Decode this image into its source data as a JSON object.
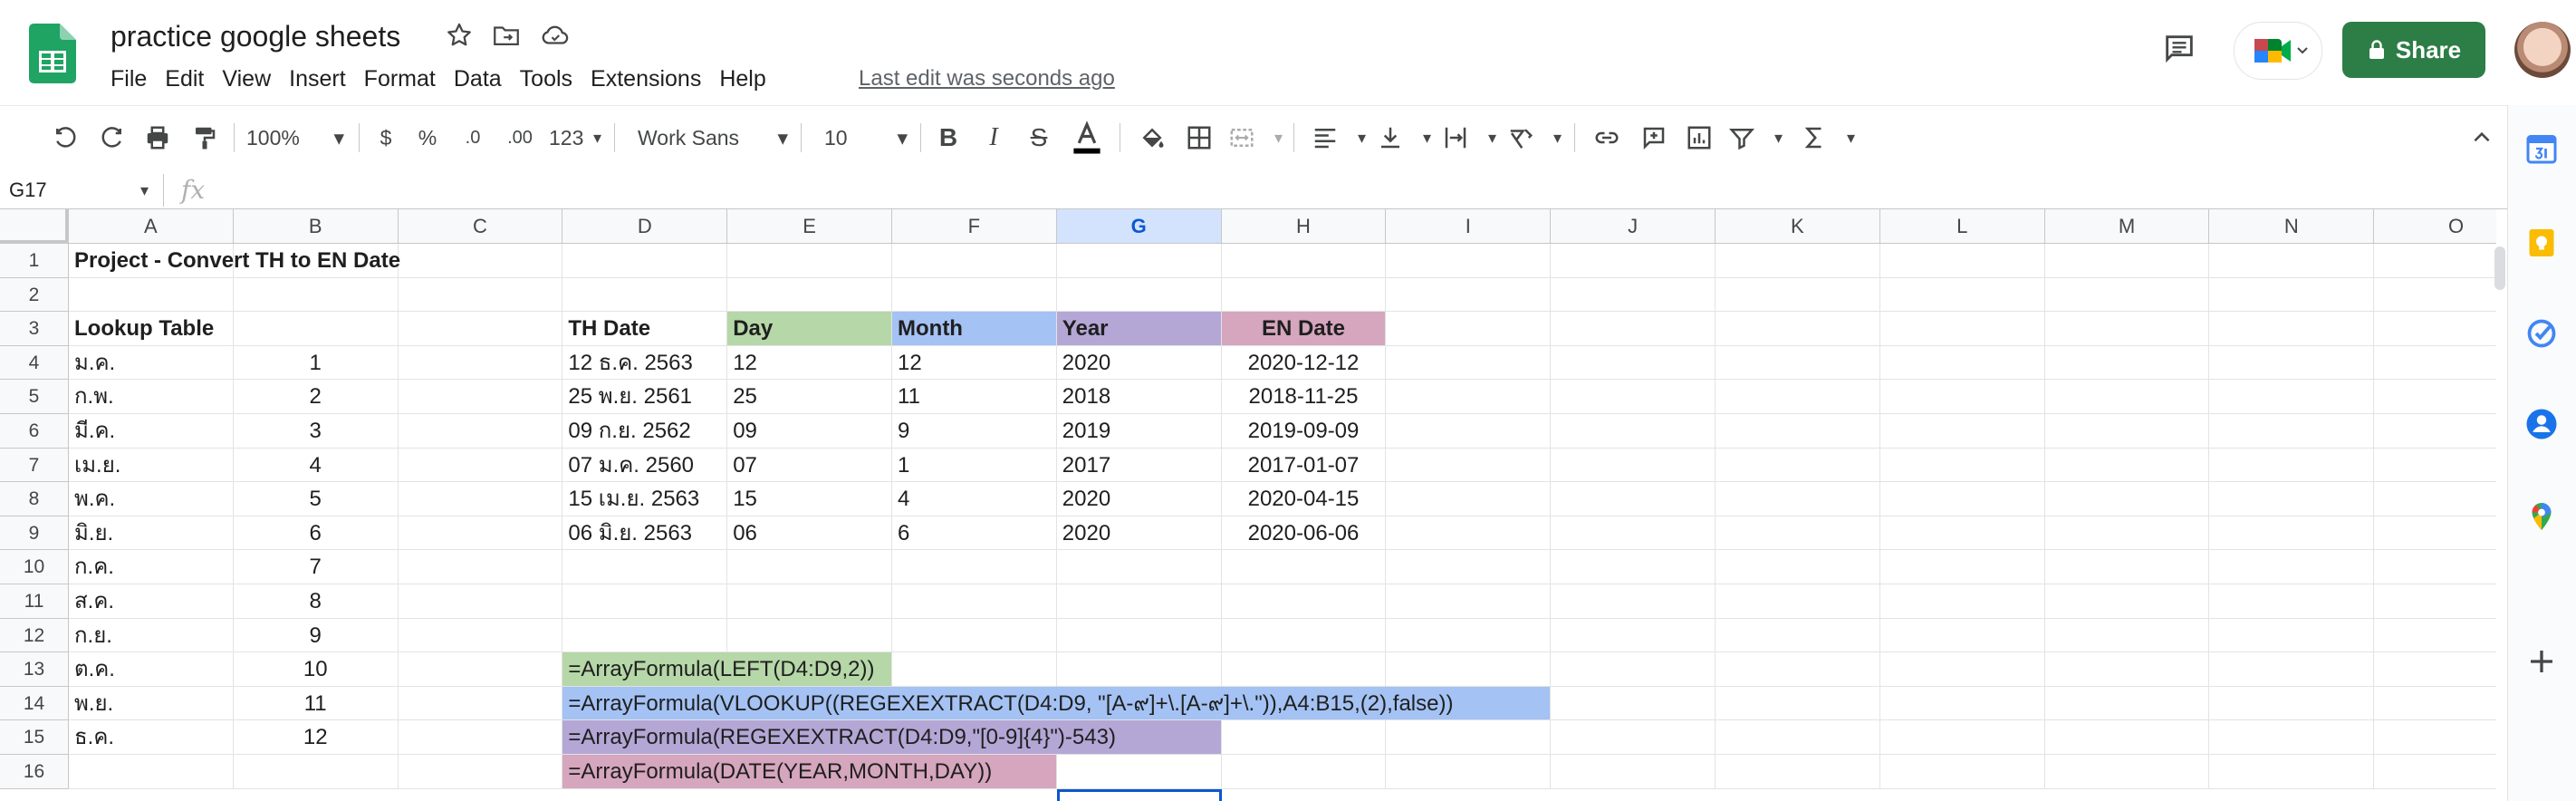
{
  "app": {
    "title": "practice google sheets",
    "last_edit": "Last edit was seconds ago",
    "share_label": "Share"
  },
  "menu": [
    "File",
    "Edit",
    "View",
    "Insert",
    "Format",
    "Data",
    "Tools",
    "Extensions",
    "Help"
  ],
  "toolbar": {
    "zoom": "100%",
    "currency": "$",
    "percent": "%",
    "dec_decrease": ".0",
    "dec_increase": ".00",
    "more_formats": "123",
    "font": "Work Sans",
    "font_size": "10"
  },
  "formula_bar": {
    "name_box": "G17",
    "fx": "fx",
    "value": ""
  },
  "grid": {
    "columns": [
      "A",
      "B",
      "C",
      "D",
      "E",
      "F",
      "G",
      "H",
      "I",
      "J",
      "K",
      "L",
      "M",
      "N",
      "O"
    ],
    "selected_column": "G",
    "rows": [
      "1",
      "2",
      "3",
      "4",
      "5",
      "6",
      "7",
      "8",
      "9",
      "10",
      "11",
      "12",
      "13",
      "14",
      "15",
      "16"
    ],
    "cells": [
      {
        "ref": "A1",
        "value": "Project - Convert TH to EN Date",
        "bold": true
      },
      {
        "ref": "A3",
        "value": "Lookup Table",
        "bold": true
      },
      {
        "ref": "D3",
        "value": "TH Date",
        "bold": true
      },
      {
        "ref": "E3",
        "value": "Day",
        "bold": true,
        "fill": "#b6d7a8"
      },
      {
        "ref": "F3",
        "value": "Month",
        "bold": true,
        "fill": "#a4c2f4"
      },
      {
        "ref": "G3",
        "value": "Year",
        "bold": true,
        "fill": "#b4a7d6"
      },
      {
        "ref": "H3",
        "value": "EN Date",
        "bold": true,
        "fill": "#d5a6bd",
        "align": "center"
      },
      {
        "ref": "A4",
        "value": "ม.ค."
      },
      {
        "ref": "B4",
        "value": "1",
        "align": "center"
      },
      {
        "ref": "A5",
        "value": "ก.พ."
      },
      {
        "ref": "B5",
        "value": "2",
        "align": "center"
      },
      {
        "ref": "A6",
        "value": "มี.ค."
      },
      {
        "ref": "B6",
        "value": "3",
        "align": "center"
      },
      {
        "ref": "A7",
        "value": "เม.ย."
      },
      {
        "ref": "B7",
        "value": "4",
        "align": "center"
      },
      {
        "ref": "A8",
        "value": "พ.ค."
      },
      {
        "ref": "B8",
        "value": "5",
        "align": "center"
      },
      {
        "ref": "A9",
        "value": "มิ.ย."
      },
      {
        "ref": "B9",
        "value": "6",
        "align": "center"
      },
      {
        "ref": "A10",
        "value": "ก.ค."
      },
      {
        "ref": "B10",
        "value": "7",
        "align": "center"
      },
      {
        "ref": "A11",
        "value": "ส.ค."
      },
      {
        "ref": "B11",
        "value": "8",
        "align": "center"
      },
      {
        "ref": "A12",
        "value": "ก.ย."
      },
      {
        "ref": "B12",
        "value": "9",
        "align": "center"
      },
      {
        "ref": "A13",
        "value": "ต.ค."
      },
      {
        "ref": "B13",
        "value": "10",
        "align": "center"
      },
      {
        "ref": "A14",
        "value": "พ.ย."
      },
      {
        "ref": "B14",
        "value": "11",
        "align": "center"
      },
      {
        "ref": "A15",
        "value": "ธ.ค."
      },
      {
        "ref": "B15",
        "value": "12",
        "align": "center"
      },
      {
        "ref": "D4",
        "value": "12 ธ.ค. 2563"
      },
      {
        "ref": "E4",
        "value": "12"
      },
      {
        "ref": "F4",
        "value": "12"
      },
      {
        "ref": "G4",
        "value": "2020"
      },
      {
        "ref": "H4",
        "value": "2020-12-12",
        "align": "center"
      },
      {
        "ref": "D5",
        "value": "25 พ.ย. 2561"
      },
      {
        "ref": "E5",
        "value": "25"
      },
      {
        "ref": "F5",
        "value": "11"
      },
      {
        "ref": "G5",
        "value": "2018"
      },
      {
        "ref": "H5",
        "value": "2018-11-25",
        "align": "center"
      },
      {
        "ref": "D6",
        "value": "09 ก.ย. 2562"
      },
      {
        "ref": "E6",
        "value": "09"
      },
      {
        "ref": "F6",
        "value": "9"
      },
      {
        "ref": "G6",
        "value": "2019"
      },
      {
        "ref": "H6",
        "value": "2019-09-09",
        "align": "center"
      },
      {
        "ref": "D7",
        "value": "07 ม.ค. 2560"
      },
      {
        "ref": "E7",
        "value": "07"
      },
      {
        "ref": "F7",
        "value": "1"
      },
      {
        "ref": "G7",
        "value": "2017"
      },
      {
        "ref": "H7",
        "value": "2017-01-07",
        "align": "center"
      },
      {
        "ref": "D8",
        "value": "15 เม.ย. 2563"
      },
      {
        "ref": "E8",
        "value": "15"
      },
      {
        "ref": "F8",
        "value": "4"
      },
      {
        "ref": "G8",
        "value": "2020"
      },
      {
        "ref": "H8",
        "value": "2020-04-15",
        "align": "center"
      },
      {
        "ref": "D9",
        "value": "06 มิ.ย. 2563"
      },
      {
        "ref": "E9",
        "value": "06"
      },
      {
        "ref": "F9",
        "value": "6"
      },
      {
        "ref": "G9",
        "value": "2020"
      },
      {
        "ref": "H9",
        "value": "2020-06-06",
        "align": "center"
      }
    ],
    "formula_notes": [
      {
        "ref": "D13",
        "span": 2,
        "value": "=ArrayFormula(LEFT(D4:D9,2))",
        "fill": "#b6d7a8"
      },
      {
        "ref": "D14",
        "span": 6,
        "value": "=ArrayFormula(VLOOKUP((REGEXEXTRACT(D4:D9, \"[A-๙]+\\.[A-๙]+\\.\")),A4:B15,(2),false))",
        "fill": "#a4c2f4"
      },
      {
        "ref": "D15",
        "span": 4,
        "value": "=ArrayFormula(REGEXEXTRACT(D4:D9,\"[0-9]{4}\")-543)",
        "fill": "#b4a7d6"
      },
      {
        "ref": "D16",
        "span": 3,
        "value": "=ArrayFormula(DATE(YEAR,MONTH,DAY))",
        "fill": "#d5a6bd"
      }
    ]
  },
  "colors": {
    "share_green": "#2d7d46",
    "selection_blue": "#0b57d0",
    "sheets_green": "#1fa463"
  }
}
